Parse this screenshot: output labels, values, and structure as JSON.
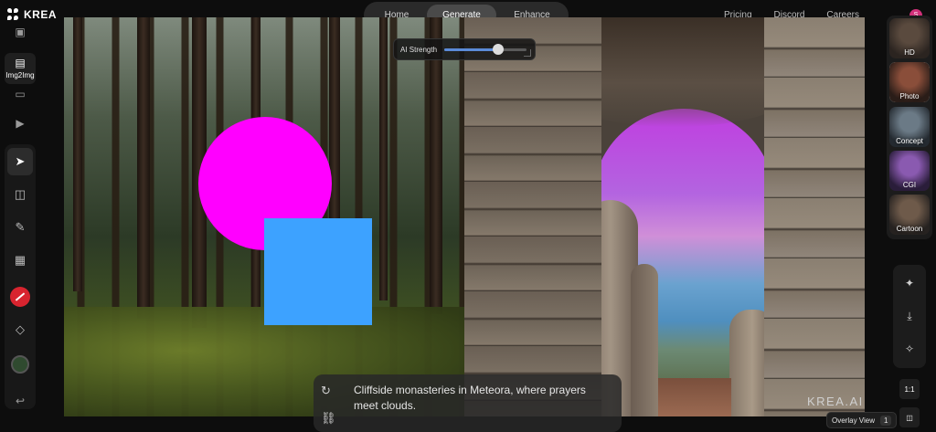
{
  "brand": "KREA",
  "nav": {
    "tabs": [
      "Home",
      "Generate",
      "Enhance"
    ],
    "active": "Generate"
  },
  "top_links": [
    "Pricing",
    "Discord",
    "Careers"
  ],
  "notification_letter": "S",
  "left_sidebar": {
    "img2img_label": "Img2Img",
    "icons": [
      "image-icon",
      "desktop-icon",
      "video-icon"
    ],
    "tools": [
      "cursor-icon",
      "layers-icon",
      "brush-icon",
      "image-upload-icon",
      "color-icon",
      "eraser-icon",
      "thumbnail-icon"
    ],
    "undo_icon": "undo-icon"
  },
  "slider": {
    "label": "AI Strength",
    "value": 0.65
  },
  "prompt": {
    "text": "Cliffside monasteries in Meteora, where prayers meet clouds."
  },
  "watermark": "KREA.AI",
  "overlay_view": {
    "label": "Overlay View",
    "count": "1"
  },
  "styles": [
    {
      "label": "HD",
      "colors": [
        "#5a4a3e",
        "#2b2420"
      ]
    },
    {
      "label": "Photo",
      "colors": [
        "#8a4e3a",
        "#2a1d18"
      ]
    },
    {
      "label": "Concept",
      "colors": [
        "#6b7a86",
        "#242a30"
      ]
    },
    {
      "label": "CGI",
      "colors": [
        "#8a5ab0",
        "#2a1d3a"
      ]
    },
    {
      "label": "Cartoon",
      "colors": [
        "#6e5a4a",
        "#262220"
      ]
    }
  ],
  "selected_style": "Photo",
  "right_tools": [
    "enhance-icon",
    "download-icon",
    "magic-icon"
  ],
  "aspect_label": "1:1",
  "shape_colors": {
    "circle": "#ff00ff",
    "square": "#3da2ff"
  }
}
